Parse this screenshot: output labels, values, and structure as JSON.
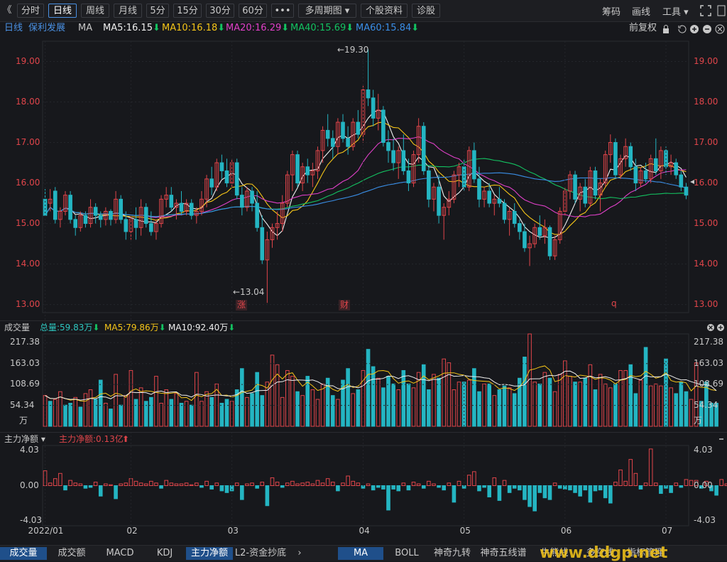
{
  "toolbar": {
    "back": "《",
    "periods": [
      "分时",
      "日线",
      "周线",
      "月线",
      "5分",
      "15分",
      "30分",
      "60分",
      "•••",
      "多周期图 ▾",
      "个股资料",
      "诊股"
    ],
    "active_index": 1,
    "right_tools": [
      "筹码",
      "画线",
      "工具 ▾"
    ]
  },
  "legend": {
    "period": "日线",
    "stock": "保利发展",
    "indicator": "MA",
    "items": [
      {
        "text": "MA5:16.15",
        "arrow": "⬇",
        "color": "#f0f0f0",
        "arrow_color": "#13c261"
      },
      {
        "text": "MA10:16.18",
        "arrow": "⬇",
        "color": "#f5c518",
        "arrow_color": "#13c261"
      },
      {
        "text": "MA20:16.29",
        "arrow": "⬇",
        "color": "#e040c8",
        "arrow_color": "#13c261"
      },
      {
        "text": "MA40:15.69",
        "arrow": "⬇",
        "color": "#13c261",
        "arrow_color": "#13c261"
      },
      {
        "text": "MA60:15.84",
        "arrow": "⬇",
        "color": "#3a8ee6",
        "arrow_color": "#13c261"
      }
    ],
    "adjust": "前复权"
  },
  "markers": {
    "high_label": "←19.30",
    "low_label": "←13.04",
    "m1": "涨",
    "m2": "财",
    "m3": "q"
  },
  "volume_head": {
    "title": "成交量",
    "items": [
      {
        "text": "总量:59.83万",
        "arrow": "⬇",
        "color": "#2ec7c0"
      },
      {
        "text": "MA5:79.86万",
        "arrow": "⬇",
        "color": "#f5c518"
      },
      {
        "text": "MA10:92.40万",
        "arrow": "⬇",
        "color": "#f0f0f0"
      }
    ],
    "unit": "万"
  },
  "flow_head": {
    "title": "主力净额 ▾",
    "item": "主力净额:0.13亿",
    "arrow": "⬆"
  },
  "x_labels": [
    "2022/01",
    "02",
    "03",
    "04",
    "05",
    "06",
    "07"
  ],
  "bottom_tabs_left": [
    "成交量",
    "成交额",
    "MACD",
    "KDJ",
    "主力净额",
    "L2-资金抄底"
  ],
  "bottom_tabs_right": [
    "MA",
    "BOLL",
    "神奇九转",
    "神奇五线谱",
    "牛熊线",
    "多空线",
    "指标管理"
  ],
  "watermark": "www.ddgp.net",
  "colors": {
    "up": "#e0454a",
    "down": "#24b5c2",
    "bg": "#17181c"
  },
  "chart_data": [
    {
      "type": "candlestick",
      "title": "保利发展 日线",
      "ylim": [
        12.8,
        19.5
      ],
      "yticks": [
        13.0,
        14.0,
        15.0,
        16.0,
        17.0,
        18.0,
        19.0
      ],
      "ohlc": [
        [
          15.6,
          15.85,
          15.4,
          15.2
        ],
        [
          15.5,
          15.85,
          15.3,
          15.6
        ],
        [
          15.8,
          15.9,
          15.0,
          15.1
        ],
        [
          15.1,
          15.4,
          14.9,
          15.3
        ],
        [
          15.3,
          15.8,
          15.2,
          15.7
        ],
        [
          15.7,
          15.8,
          15.0,
          15.1
        ],
        [
          15.1,
          15.2,
          14.7,
          14.9
        ],
        [
          14.9,
          15.3,
          14.8,
          15.2
        ],
        [
          15.2,
          15.3,
          14.9,
          15.0
        ],
        [
          15.0,
          15.6,
          14.9,
          15.4
        ],
        [
          15.4,
          15.5,
          15.0,
          15.2
        ],
        [
          15.2,
          15.3,
          14.9,
          15.1
        ],
        [
          15.1,
          15.4,
          14.95,
          15.3
        ],
        [
          15.3,
          15.35,
          14.95,
          15.1
        ],
        [
          15.1,
          15.8,
          15.0,
          15.6
        ],
        [
          15.6,
          15.7,
          15.0,
          15.1
        ],
        [
          15.1,
          15.3,
          14.6,
          14.8
        ],
        [
          14.8,
          15.2,
          14.6,
          15.1
        ],
        [
          15.1,
          15.4,
          14.6,
          14.9
        ],
        [
          14.9,
          15.6,
          14.7,
          15.4
        ],
        [
          15.4,
          15.5,
          14.9,
          15.0
        ],
        [
          15.0,
          15.3,
          14.7,
          14.8
        ],
        [
          14.8,
          15.1,
          14.6,
          15.0
        ],
        [
          15.0,
          15.7,
          14.9,
          15.6
        ],
        [
          15.6,
          15.9,
          15.4,
          15.7
        ],
        [
          15.7,
          15.9,
          15.3,
          15.4
        ],
        [
          15.4,
          15.6,
          15.1,
          15.5
        ],
        [
          15.5,
          15.8,
          15.2,
          15.3
        ],
        [
          15.3,
          15.6,
          15.2,
          15.5
        ],
        [
          15.5,
          15.6,
          15.1,
          15.2
        ],
        [
          15.2,
          15.4,
          15.0,
          15.3
        ],
        [
          15.3,
          15.8,
          15.2,
          15.6
        ],
        [
          15.6,
          16.2,
          15.4,
          16.1
        ],
        [
          16.1,
          16.4,
          15.7,
          15.9
        ],
        [
          15.9,
          16.6,
          15.8,
          16.5
        ],
        [
          16.5,
          16.7,
          16.1,
          16.3
        ],
        [
          16.3,
          16.6,
          15.9,
          16.0
        ],
        [
          16.0,
          16.6,
          15.9,
          16.5
        ],
        [
          16.5,
          16.6,
          15.6,
          15.7
        ],
        [
          15.7,
          15.9,
          15.2,
          15.4
        ],
        [
          15.4,
          15.9,
          15.3,
          15.8
        ],
        [
          15.8,
          15.9,
          15.3,
          15.5
        ],
        [
          15.5,
          15.8,
          14.8,
          14.9
        ],
        [
          14.9,
          15.2,
          14.0,
          14.1
        ],
        [
          14.1,
          14.8,
          13.04,
          14.6
        ],
        [
          14.6,
          15.0,
          14.4,
          14.9
        ],
        [
          14.9,
          15.3,
          14.6,
          15.0
        ],
        [
          15.0,
          15.7,
          14.8,
          15.5
        ],
        [
          15.5,
          16.3,
          15.4,
          16.2
        ],
        [
          16.2,
          16.8,
          15.8,
          16.7
        ],
        [
          16.7,
          16.8,
          15.9,
          16.0
        ],
        [
          16.0,
          16.5,
          15.8,
          16.4
        ],
        [
          16.4,
          16.6,
          16.0,
          16.2
        ],
        [
          16.2,
          16.5,
          15.9,
          16.3
        ],
        [
          16.3,
          16.9,
          16.1,
          16.8
        ],
        [
          16.8,
          17.4,
          16.5,
          17.3
        ],
        [
          17.3,
          17.7,
          16.9,
          17.1
        ],
        [
          17.1,
          17.3,
          16.6,
          16.9
        ],
        [
          16.9,
          17.6,
          16.7,
          17.5
        ],
        [
          17.5,
          17.7,
          17.0,
          17.1
        ],
        [
          17.1,
          17.4,
          16.7,
          16.9
        ],
        [
          16.9,
          17.6,
          16.8,
          17.5
        ],
        [
          17.5,
          17.8,
          17.1,
          17.2
        ],
        [
          17.2,
          18.4,
          17.0,
          18.3
        ],
        [
          18.3,
          19.3,
          17.9,
          18.1
        ],
        [
          18.1,
          18.3,
          17.4,
          17.6
        ],
        [
          17.6,
          18.2,
          17.3,
          17.8
        ],
        [
          17.8,
          17.9,
          16.9,
          17.0
        ],
        [
          17.0,
          17.3,
          16.5,
          16.8
        ],
        [
          16.8,
          17.1,
          16.3,
          16.5
        ],
        [
          16.5,
          16.9,
          16.1,
          16.8
        ],
        [
          16.8,
          17.2,
          16.2,
          16.3
        ],
        [
          16.3,
          16.6,
          15.8,
          16.0
        ],
        [
          16.0,
          16.8,
          15.9,
          16.7
        ],
        [
          16.7,
          17.6,
          16.5,
          17.4
        ],
        [
          17.4,
          17.5,
          16.2,
          16.3
        ],
        [
          16.3,
          16.4,
          15.4,
          15.6
        ],
        [
          15.6,
          16.0,
          15.3,
          15.9
        ],
        [
          15.9,
          16.2,
          15.0,
          15.2
        ],
        [
          15.2,
          15.5,
          14.6,
          15.4
        ],
        [
          15.4,
          15.8,
          15.2,
          15.6
        ],
        [
          15.6,
          16.3,
          15.5,
          16.2
        ],
        [
          16.2,
          16.5,
          15.9,
          16.4
        ],
        [
          16.4,
          16.6,
          15.8,
          15.9
        ],
        [
          15.9,
          16.9,
          15.8,
          16.8
        ],
        [
          16.8,
          17.0,
          16.0,
          16.1
        ],
        [
          16.1,
          16.4,
          15.4,
          15.6
        ],
        [
          15.6,
          15.9,
          15.4,
          15.8
        ],
        [
          15.8,
          16.0,
          15.4,
          15.5
        ],
        [
          15.5,
          15.7,
          15.2,
          15.6
        ],
        [
          15.6,
          15.9,
          15.4,
          15.5
        ],
        [
          15.5,
          15.6,
          15.0,
          15.1
        ],
        [
          15.1,
          15.4,
          14.7,
          15.3
        ],
        [
          15.3,
          15.5,
          14.9,
          15.0
        ],
        [
          15.0,
          15.1,
          14.6,
          14.8
        ],
        [
          14.8,
          15.0,
          14.3,
          14.4
        ],
        [
          14.4,
          14.7,
          13.95,
          14.5
        ],
        [
          14.5,
          15.0,
          14.4,
          14.9
        ],
        [
          14.9,
          15.2,
          14.6,
          14.7
        ],
        [
          14.7,
          15.1,
          14.5,
          14.9
        ],
        [
          14.9,
          14.95,
          14.1,
          14.2
        ],
        [
          14.2,
          14.7,
          14.1,
          14.6
        ],
        [
          14.6,
          15.4,
          14.5,
          15.3
        ],
        [
          15.3,
          15.9,
          15.2,
          15.8
        ],
        [
          15.8,
          16.3,
          15.6,
          16.2
        ],
        [
          16.2,
          16.3,
          15.5,
          15.6
        ],
        [
          15.6,
          16.0,
          15.3,
          15.9
        ],
        [
          15.9,
          16.1,
          15.4,
          15.5
        ],
        [
          15.5,
          16.4,
          15.4,
          16.3
        ],
        [
          16.3,
          16.4,
          15.6,
          15.7
        ],
        [
          15.7,
          16.1,
          15.3,
          16.0
        ],
        [
          16.0,
          16.8,
          15.9,
          16.7
        ],
        [
          16.7,
          17.2,
          16.5,
          17.0
        ],
        [
          17.0,
          17.1,
          16.1,
          16.2
        ],
        [
          16.2,
          16.7,
          16.1,
          16.6
        ],
        [
          16.6,
          17.1,
          16.4,
          16.9
        ],
        [
          16.9,
          17.0,
          16.3,
          16.4
        ],
        [
          16.4,
          16.6,
          15.8,
          16.0
        ],
        [
          16.0,
          16.4,
          15.9,
          16.3
        ],
        [
          16.3,
          16.5,
          16.0,
          16.1
        ],
        [
          16.1,
          16.7,
          16.0,
          16.6
        ],
        [
          16.6,
          17.1,
          16.2,
          16.3
        ],
        [
          16.3,
          16.9,
          16.1,
          16.8
        ],
        [
          16.8,
          16.9,
          16.2,
          16.4
        ],
        [
          16.4,
          16.7,
          16.2,
          16.5
        ],
        [
          16.5,
          16.6,
          16.1,
          16.2
        ],
        [
          16.2,
          16.3,
          15.8,
          15.9
        ],
        [
          15.9,
          16.0,
          15.6,
          15.7
        ]
      ]
    },
    {
      "type": "bar",
      "title": "成交量",
      "ylabel": "万",
      "yticks": [
        "217.38",
        "163.03",
        "108.69",
        "54.34"
      ],
      "ylim": [
        0,
        240
      ],
      "values": [
        80,
        65,
        70,
        90,
        55,
        60,
        75,
        50,
        85,
        95,
        70,
        120,
        60,
        45,
        135,
        55,
        80,
        145,
        70,
        100,
        65,
        75,
        130,
        60,
        95,
        70,
        85,
        60,
        65,
        55,
        140,
        65,
        90,
        75,
        110,
        60,
        70,
        65,
        95,
        150,
        75,
        85,
        140,
        80,
        115,
        185,
        160,
        75,
        145,
        130,
        90,
        80,
        130,
        95,
        70,
        110,
        125,
        80,
        70,
        120,
        150,
        85,
        95,
        145,
        200,
        155,
        125,
        100,
        130,
        110,
        95,
        145,
        110,
        100,
        140,
        160,
        95,
        135,
        125,
        175,
        165,
        95,
        115,
        115,
        120,
        150,
        90,
        110,
        110,
        80,
        95,
        105,
        100,
        85,
        125,
        180,
        240,
        115,
        110,
        140,
        125,
        90,
        135,
        170,
        130,
        115,
        115,
        125,
        160,
        95,
        135,
        110,
        100,
        110,
        145,
        145,
        160,
        85,
        120,
        205,
        105,
        110,
        105,
        175,
        100,
        85,
        115,
        90,
        70,
        165,
        65,
        115,
        60,
        60
      ],
      "is_up": [
        true,
        false,
        true,
        true,
        false,
        false,
        true,
        false,
        true,
        true,
        false,
        false,
        true,
        false,
        true,
        false,
        true,
        true,
        false,
        true,
        false,
        false,
        true,
        true,
        true,
        false,
        true,
        false,
        true,
        false,
        true,
        true,
        true,
        false,
        true,
        false,
        false,
        true,
        false,
        false,
        true,
        false,
        false,
        false,
        true,
        true,
        true,
        true,
        true,
        true,
        false,
        true,
        false,
        true,
        true,
        true,
        false,
        false,
        true,
        false,
        false,
        true,
        false,
        true,
        false,
        false,
        true,
        false,
        false,
        false,
        true,
        false,
        false,
        true,
        true,
        false,
        false,
        true,
        false,
        true,
        true,
        true,
        true,
        false,
        true,
        false,
        false,
        true,
        false,
        true,
        false,
        false,
        true,
        false,
        false,
        false,
        true,
        true,
        false,
        true,
        false,
        true,
        true,
        true,
        true,
        false,
        true,
        false,
        true,
        false,
        true,
        true,
        true,
        false,
        true,
        true,
        false,
        false,
        true,
        false,
        true,
        true,
        true,
        false,
        true,
        false,
        false,
        false,
        true,
        true,
        false,
        false,
        false,
        false
      ]
    },
    {
      "type": "bar",
      "title": "主力净额",
      "yticks": [
        "4.03",
        "0.00",
        "-4.03"
      ],
      "ylim": [
        -4.6,
        4.6
      ],
      "values": [
        1.7,
        0.3,
        0.8,
        1.4,
        -0.5,
        0.6,
        0.3,
        0.2,
        -0.3,
        -0.2,
        0.4,
        -1.2,
        0.2,
        0.1,
        -1.5,
        0.2,
        0.3,
        0.8,
        0.5,
        0.3,
        0.2,
        0.5,
        0.3,
        -0.3,
        0.6,
        0.3,
        0.2,
        0.2,
        0.3,
        0.1,
        0.3,
        -0.2,
        0.5,
        -0.4,
        0.3,
        -0.6,
        -0.8,
        -0.6,
        0.3,
        -1.6,
        0.2,
        0.3,
        -0.3,
        0.4,
        -2.3,
        0.9,
        0.4,
        -0.2,
        0.3,
        0.5,
        0.2,
        0.3,
        0.4,
        0.2,
        0.6,
        0.3,
        0.8,
        0.4,
        -0.6,
        0.3,
        1.1,
        0.5,
        0.3,
        -0.3,
        0.2,
        -0.5,
        -0.2,
        -0.4,
        -2.8,
        -0.4,
        -0.6,
        0.3,
        -0.5,
        0.4,
        0.2,
        -0.3,
        0.5,
        0.2,
        -0.2,
        -0.5,
        0.3,
        -1.9,
        0.5,
        -0.3,
        1.2,
        1.6,
        -0.6,
        -0.2,
        -1.3,
        0.9,
        -1.7,
        0.6,
        -0.8,
        -0.3,
        -0.5,
        -1.6,
        -2.4,
        -2.9,
        -0.8,
        -1.4,
        -1.6,
        0.3,
        -0.3,
        -0.4,
        -0.5,
        -0.8,
        -1.2,
        -0.5,
        -1.9,
        -0.6,
        -0.5,
        -1.4,
        -2.0,
        0.4,
        1.8,
        0.5,
        3.0,
        1.4,
        -0.4,
        0.3,
        4.2,
        0.3,
        -0.9,
        -0.3,
        -0.8,
        0.3,
        -0.2,
        0.7,
        0.6,
        0.6,
        -0.3,
        0.5,
        -0.6,
        -1.1,
        0.7,
        0.2,
        0.2,
        -1.5,
        0.1,
        0.13
      ]
    }
  ]
}
